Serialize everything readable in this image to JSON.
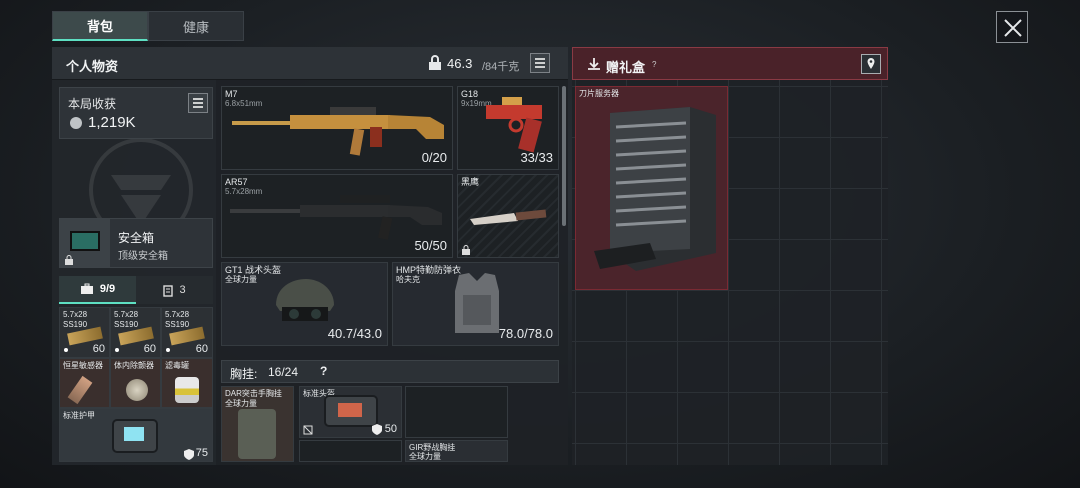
{
  "tabs": [
    "背包",
    "健康"
  ],
  "personal": {
    "title": "个人物资",
    "weight_current": "46.3",
    "weight_max": "/84千克"
  },
  "gift": {
    "title": "赠礼盒",
    "help": "?",
    "item_label": "刀片服务器"
  },
  "harvest": {
    "title": "本局收获",
    "value": "1,219K"
  },
  "safebox": {
    "title": "安全箱",
    "subtitle": "顶级安全箱"
  },
  "pouch_tabs": {
    "a": "9/9",
    "b": "3"
  },
  "weapons": [
    {
      "name": "M7",
      "caliber": "6.8x51mm",
      "ammo": "0/20"
    },
    {
      "name": "G18",
      "caliber": "9x19mm",
      "ammo": "33/33"
    },
    {
      "name": "AR57",
      "caliber": "5.7x28mm",
      "ammo": "50/50"
    },
    {
      "name": "黑鹰",
      "caliber": "",
      "ammo": ""
    }
  ],
  "armor": [
    {
      "name": "GT1 战术头盔",
      "brand": "全球力量",
      "value": "40.7/43.0"
    },
    {
      "name": "HMP特勤防弹衣",
      "brand": "哈夫克",
      "value": "78.0/78.0"
    }
  ],
  "small_items": [
    {
      "label": "5.7x28\nSS190",
      "count": "60"
    },
    {
      "label": "5.7x28\nSS190",
      "count": "60"
    },
    {
      "label": "5.7x28\nSS190",
      "count": "60"
    },
    {
      "label": "恒星敏感器",
      "count": ""
    },
    {
      "label": "体内除颤器",
      "count": ""
    },
    {
      "label": "滤毒罐",
      "count": ""
    }
  ],
  "bottom_item": {
    "label": "标准护甲",
    "value": "75"
  },
  "chest": {
    "label": "胸挂:",
    "value": "16/24",
    "help": "?"
  },
  "chest_items": [
    {
      "name": "DAR突击手胸挂",
      "brand": "全球力量"
    },
    {
      "name": "标准头盔",
      "value": "50"
    },
    {
      "name": "GIR野战胸挂",
      "brand": "全球力量"
    }
  ],
  "colors": {
    "accent": "#5ee0c3",
    "gift_red": "#7a2a33"
  }
}
